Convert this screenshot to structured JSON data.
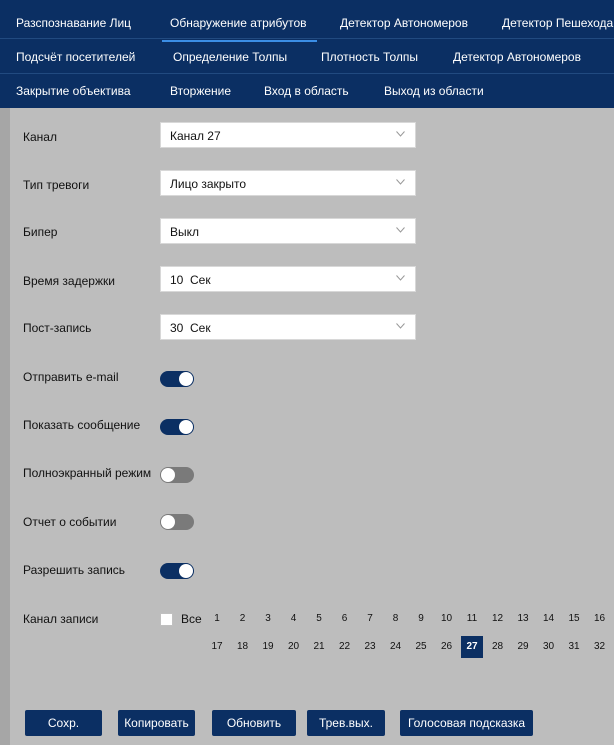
{
  "nav": {
    "row1": [
      "Разспознавание Лиц",
      "Обнаружение атрибутов",
      "Детектор Автономеров",
      "Детектор Пешехода"
    ],
    "row2": [
      "Подсчёт посетителей",
      "Определение Толпы",
      "Плотность Толпы",
      "Детектор Автономеров"
    ],
    "row3": [
      "Закрытие объектива",
      "Вторжение",
      "Вход в область",
      "Выход из области"
    ]
  },
  "form": {
    "channel": {
      "label": "Канал",
      "value": "Канал 27"
    },
    "alarm_type": {
      "label": "Тип тревоги",
      "value": "Лицо закрыто"
    },
    "buzzer": {
      "label": "Бипер",
      "value": "Выкл"
    },
    "delay": {
      "label": "Время задержки",
      "value": "10  Сек"
    },
    "post_record": {
      "label": "Пост-запись",
      "value": "30  Сек"
    },
    "send_email": {
      "label": "Отправить e-mail",
      "on": true
    },
    "show_message": {
      "label": "Показать сообщение",
      "on": true
    },
    "fullscreen": {
      "label": "Полноэкранный режим",
      "on": false
    },
    "event_report": {
      "label": "Отчет о событии",
      "on": false
    },
    "allow_record": {
      "label": "Разрешить запись",
      "on": true
    },
    "record_channel": {
      "label": "Канал записи",
      "all_label": "Все",
      "all_checked": false,
      "channels": [
        "1",
        "2",
        "3",
        "4",
        "5",
        "6",
        "7",
        "8",
        "9",
        "10",
        "11",
        "12",
        "13",
        "14",
        "15",
        "16",
        "17",
        "18",
        "19",
        "20",
        "21",
        "22",
        "23",
        "24",
        "25",
        "26",
        "27",
        "28",
        "29",
        "30",
        "31",
        "32"
      ],
      "selected": "27"
    }
  },
  "buttons": {
    "save": "Сохр.",
    "copy": "Копировать",
    "refresh": "Обновить",
    "alarm_out": "Трев.вых.",
    "voice_prompt": "Голосовая подсказка"
  },
  "colors": {
    "nav_bg": "#0b2f63",
    "active_underline": "#3b8ee6",
    "panel_bg": "#bdbdbd",
    "toggle_on": "#0b2f63",
    "toggle_off": "#7a7a7a"
  }
}
